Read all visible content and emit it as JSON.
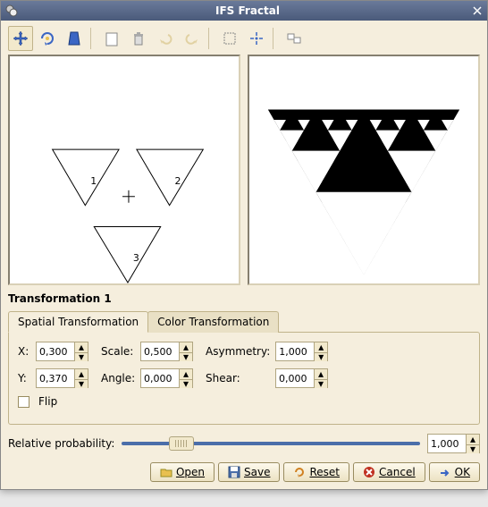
{
  "window": {
    "title": "IFS Fractal"
  },
  "toolbar": {
    "items": [
      {
        "name": "move-tool",
        "active": true
      },
      {
        "name": "rotate-scale-tool",
        "active": false
      },
      {
        "name": "stretch-tool",
        "active": false
      },
      {
        "name": "new-transform",
        "active": false
      },
      {
        "name": "delete-transform",
        "active": false
      },
      {
        "name": "undo",
        "active": false,
        "disabled": true
      },
      {
        "name": "redo",
        "active": false,
        "disabled": true
      },
      {
        "name": "select-all",
        "active": false
      },
      {
        "name": "recenter",
        "active": false
      },
      {
        "name": "render-options",
        "active": false
      }
    ]
  },
  "design": {
    "triangles": [
      {
        "label": "1"
      },
      {
        "label": "2"
      },
      {
        "label": "3"
      }
    ]
  },
  "section_title": "Transformation 1",
  "tabs": {
    "spatial": "Spatial Transformation",
    "color": "Color Transformation"
  },
  "form": {
    "x_label": "X:",
    "x_value": "0,300",
    "y_label": "Y:",
    "y_value": "0,370",
    "scale_label": "Scale:",
    "scale_value": "0,500",
    "angle_label": "Angle:",
    "angle_value": "0,000",
    "asym_label": "Asymmetry:",
    "asym_value": "1,000",
    "shear_label": "Shear:",
    "shear_value": "0,000",
    "flip_label": "Flip"
  },
  "prob": {
    "label": "Relative probability:",
    "value": "1,000",
    "pos_pct": 20
  },
  "buttons": {
    "open": "Open",
    "save": "Save",
    "reset": "Reset",
    "cancel": "Cancel",
    "ok": "OK"
  }
}
